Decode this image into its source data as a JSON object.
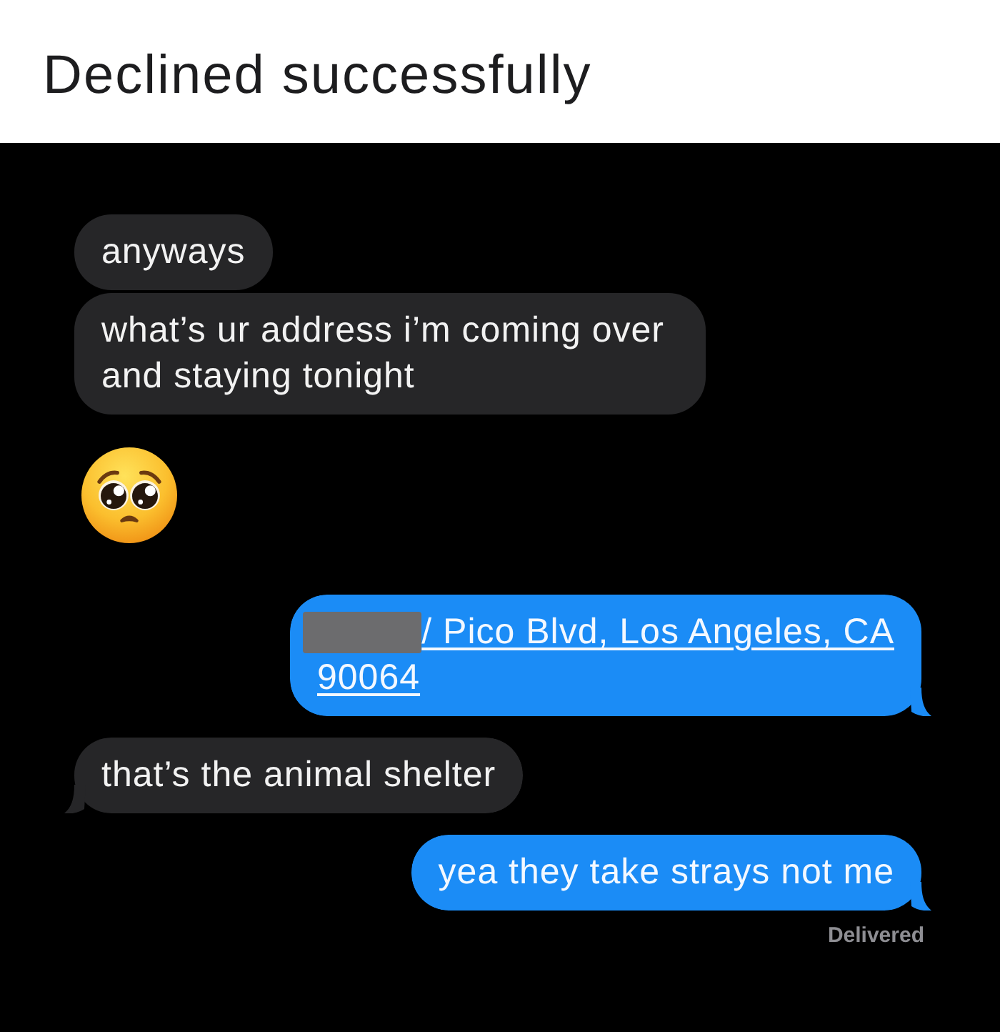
{
  "header": {
    "title": "Declined successfully"
  },
  "messages": [
    {
      "kind": "text",
      "outgoing": false,
      "tail": false,
      "text": "anyways"
    },
    {
      "kind": "text",
      "outgoing": false,
      "tail": false,
      "text": "what’s ur address i’m coming over and staying tonight"
    },
    {
      "kind": "emoji",
      "outgoing": false
    },
    {
      "kind": "address",
      "outgoing": true,
      "tail": true,
      "redacted": true,
      "lines": [
        "/ Pico Blvd, Los Angeles, CA",
        "90064"
      ]
    },
    {
      "kind": "text",
      "outgoing": false,
      "tail": true,
      "text": "that’s the animal shelter"
    },
    {
      "kind": "text",
      "outgoing": true,
      "tail": true,
      "text": "yea they take strays not me"
    }
  ],
  "status": "Delivered"
}
